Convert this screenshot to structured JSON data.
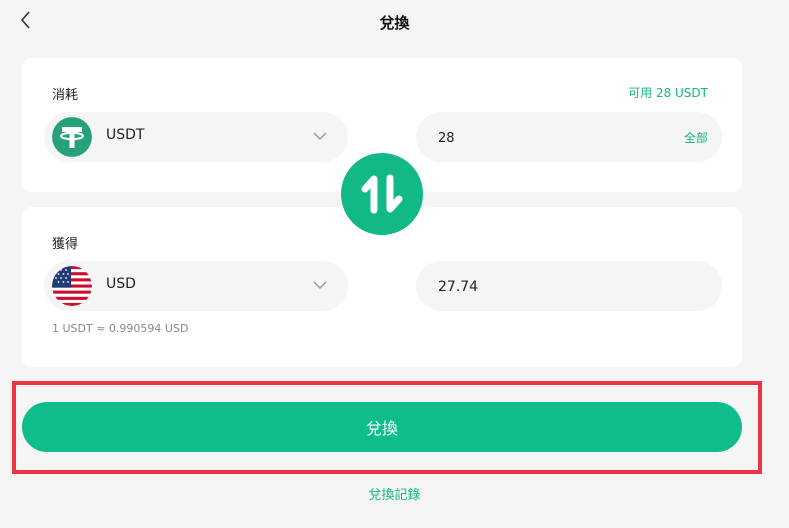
{
  "header": {
    "title": "兌換",
    "back_icon": "chevron-left-icon"
  },
  "spend": {
    "label": "消耗",
    "available": "可用 28 USDT",
    "currency": "USDT",
    "currency_icon": "tether-icon",
    "amount": "28",
    "all_label": "全部"
  },
  "swap": {
    "icon": "swap-vertical-arrows-icon"
  },
  "receive": {
    "label": "獲得",
    "currency": "USD",
    "currency_icon": "us-flag-icon",
    "amount": "27.74",
    "rate": "1 USDT ≈ 0.990594 USD"
  },
  "actions": {
    "exchange_label": "兌換",
    "history_label": "兌換記錄"
  },
  "colors": {
    "accent": "#12b886",
    "button": "#0fbd8c",
    "highlight": "#ee3344",
    "background": "#f5f5f5"
  }
}
